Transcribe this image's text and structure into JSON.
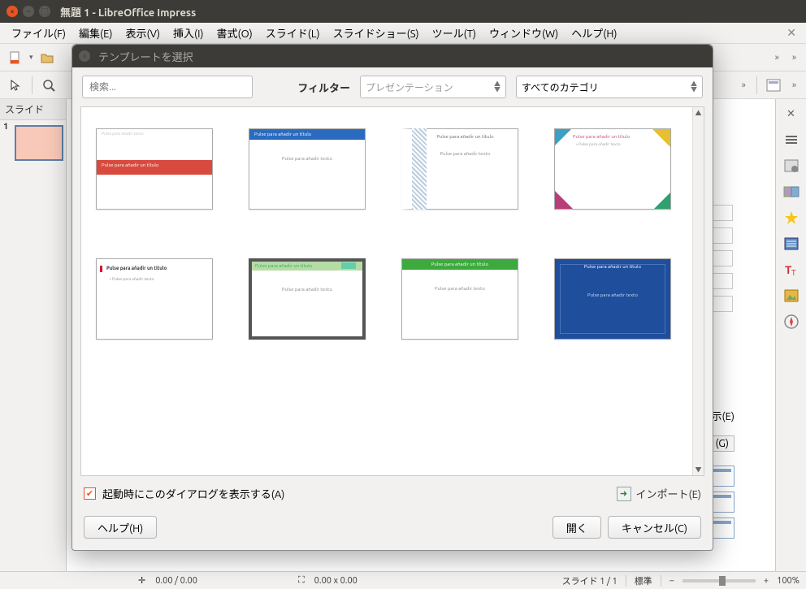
{
  "window": {
    "title": "無題 1 - LibreOffice Impress"
  },
  "menu": {
    "file": "ファイル(F)",
    "edit": "編集(E)",
    "view": "表示(V)",
    "insert": "挿入(I)",
    "format": "書式(O)",
    "slide": "スライド(L)",
    "slideshow": "スライドショー(S)",
    "tools": "ツール(T)",
    "window": "ウィンドウ(W)",
    "help": "ヘルプ(H)"
  },
  "panels": {
    "slides_title": "スライド",
    "slide_number": "1"
  },
  "right_labels": {
    "show": "示(E)",
    "g": "(G)"
  },
  "status": {
    "pos": "0.00 / 0.00",
    "size": "0.00 x 0.00",
    "slide_count": "スライド 1 / 1",
    "master": "標準",
    "zoom": "100%"
  },
  "dialog": {
    "title": "テンプレートを選択",
    "search_placeholder": "検索...",
    "filter_label": "フィルター",
    "filter_preset": "プレゼンテーション",
    "filter_category": "すべてのカテゴリ",
    "checkbox_label": "起動時にこのダイアログを表示する(A)",
    "import": "インポート(E)",
    "help": "ヘルプ(H)",
    "open": "開く",
    "cancel": "キャンセル(C)"
  },
  "templates": {
    "title_placeholder": "Pulse para añadir un título",
    "body_placeholder": "Pulse para añadir texto"
  }
}
